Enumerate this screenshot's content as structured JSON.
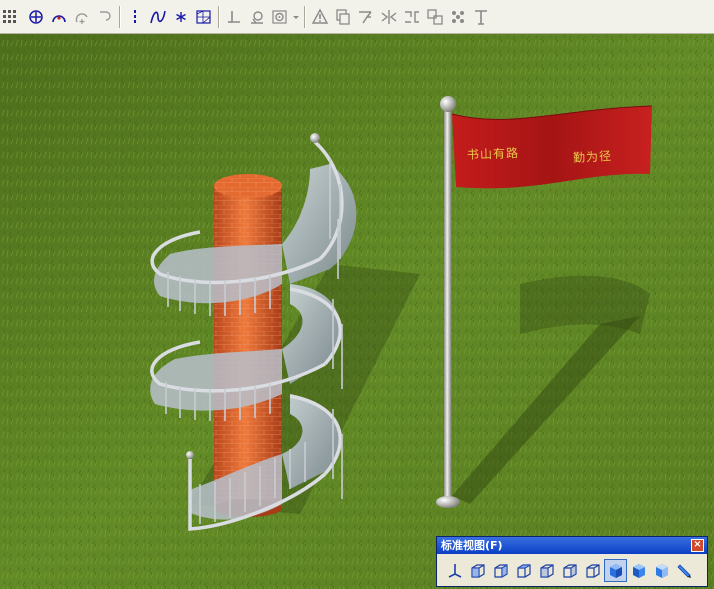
{
  "toolbar": {
    "icons": [
      "grid-snap-icon",
      "insert-point-icon",
      "arch-icon",
      "add-arc-icon",
      "polyline-icon",
      "vertical-line-icon",
      "curve-icon",
      "asterisk-icon",
      "hatch-icon",
      "foot-icon",
      "dimension-icon",
      "circle-icon",
      "dropdown-icon",
      "warning-icon",
      "copy-icon",
      "stair-icon",
      "mirror-icon",
      "array-icon",
      "offset-icon",
      "dots-icon",
      "text-icon"
    ]
  },
  "scene": {
    "flag_text_left": "书山有路",
    "flag_text_right": "勤为径",
    "colors": {
      "grass": "#5b7f22",
      "flag": "#b01818",
      "flag_text": "#e8c84a",
      "brick": "#d9602a"
    }
  },
  "view_panel": {
    "title": "标准视图(F)",
    "close_label": "×",
    "buttons": [
      "axis-view",
      "iso-view-1",
      "iso-view-2",
      "iso-view-3",
      "iso-view-4",
      "iso-view-5",
      "iso-view-6",
      "shaded-view",
      "blue-view-1",
      "blue-view-2",
      "pen-view"
    ],
    "active_index": 7
  }
}
